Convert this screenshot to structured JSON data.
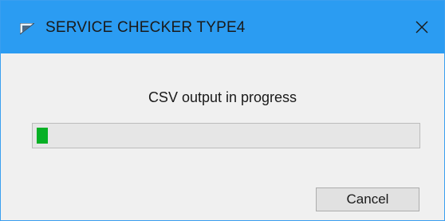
{
  "window": {
    "title": "SERVICE CHECKER TYPE4",
    "app_icon": "app-icon",
    "close_icon": "close-icon",
    "titlebar_color": "#2b9cf2"
  },
  "dialog": {
    "message": "CSV output in progress",
    "progress": {
      "value_fraction": 0.03,
      "fill_color": "#06b025"
    },
    "cancel_label": "Cancel"
  }
}
